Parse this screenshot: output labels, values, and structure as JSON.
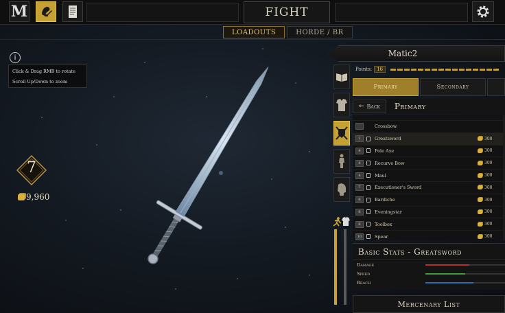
{
  "header": {
    "logo_letter": "M",
    "fight_label": "FIGHT",
    "icons": [
      "mordhau-logo-icon",
      "character-edit-icon",
      "scroll-icon",
      "gear-icon"
    ]
  },
  "subtabs": [
    {
      "label": "LOADOUTS",
      "active": true
    },
    {
      "label": "HORDE / BR",
      "active": false
    }
  ],
  "help": {
    "icon_text": "i",
    "line1": "Click & Drag RMB to rotate",
    "line2": "Scroll Up/Down to zoom"
  },
  "player": {
    "level": "7",
    "gold": "9,960"
  },
  "panel": {
    "loadout_name": "Matic2",
    "points_label": "Points:",
    "points_value": "16",
    "tabs": [
      {
        "label": "Primary",
        "active": true
      },
      {
        "label": "Secondary",
        "active": false
      }
    ],
    "back_label": "Back",
    "section_title": "Primary",
    "weapons": [
      {
        "name": "",
        "price": "",
        "locked": false,
        "partial": true
      },
      {
        "name": "Crossbow",
        "price": "",
        "locked": false,
        "noicon": true
      },
      {
        "name": "Greatsword",
        "price": "300",
        "locked": true,
        "selected": true,
        "thumb": "2"
      },
      {
        "name": "Pole Axe",
        "price": "300",
        "locked": true,
        "thumb": "4"
      },
      {
        "name": "Recurve Bow",
        "price": "300",
        "locked": true,
        "thumb": "4"
      },
      {
        "name": "Maul",
        "price": "300",
        "locked": true,
        "thumb": "4"
      },
      {
        "name": "Executioner's Sword",
        "price": "300",
        "locked": true,
        "thumb": "7"
      },
      {
        "name": "Bardiche",
        "price": "300",
        "locked": true,
        "thumb": "6"
      },
      {
        "name": "Eveningstar",
        "price": "300",
        "locked": true,
        "thumb": "6"
      },
      {
        "name": "Toolbox",
        "price": "300",
        "locked": true,
        "thumb": "6"
      },
      {
        "name": "Spear",
        "price": "300",
        "locked": true,
        "thumb": "10"
      }
    ],
    "stats_title": "Basic Stats - Greatsword",
    "stats": [
      {
        "label": "Damage",
        "value": 0.55,
        "color": "#b5302a"
      },
      {
        "label": "Speed",
        "value": 0.5,
        "color": "#3fa03a"
      },
      {
        "label": "Reach",
        "value": 0.6,
        "color": "#2a6fb5"
      }
    ],
    "mercenary_label": "Mercenary List"
  }
}
